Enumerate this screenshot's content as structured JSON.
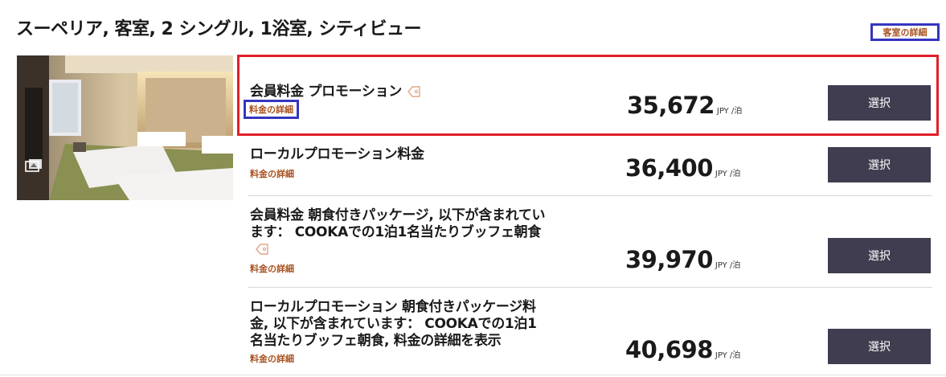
{
  "room": {
    "title": "スーペリア, 客室, 2 シングル, 1浴室, シティビュー",
    "detail_link": "客室の詳細"
  },
  "rates": [
    {
      "name": "会員料金 プロモーション",
      "has_tag": true,
      "detail_link": "料金の詳細",
      "price": "35,672",
      "unit": "JPY /泊",
      "button": "選択"
    },
    {
      "name": "ローカルプロモーション料金",
      "has_tag": false,
      "detail_link": "料金の詳細",
      "price": "36,400",
      "unit": "JPY /泊",
      "button": "選択"
    },
    {
      "name": "会員料金 朝食付きパッケージ, 以下が含まれています： COOKAでの1泊1名当たりブッフェ朝食",
      "has_tag": true,
      "detail_link": "料金の詳細",
      "price": "39,970",
      "unit": "JPY /泊",
      "button": "選択"
    },
    {
      "name": "ローカルプロモーション 朝食付きパッケージ料金, 以下が含まれています： COOKAでの1泊1名当たりブッフェ朝食, 料金の詳細を表示",
      "has_tag": false,
      "detail_link": "料金の詳細",
      "price": "40,698",
      "unit": "JPY /泊",
      "button": "選択"
    }
  ],
  "icons": {
    "tag": "tag-icon",
    "gallery": "gallery-icon"
  },
  "colors": {
    "button_bg": "#3f3d4f",
    "link": "#a8501e",
    "highlight_red": "#e0202a",
    "highlight_blue": "#3535c0"
  }
}
